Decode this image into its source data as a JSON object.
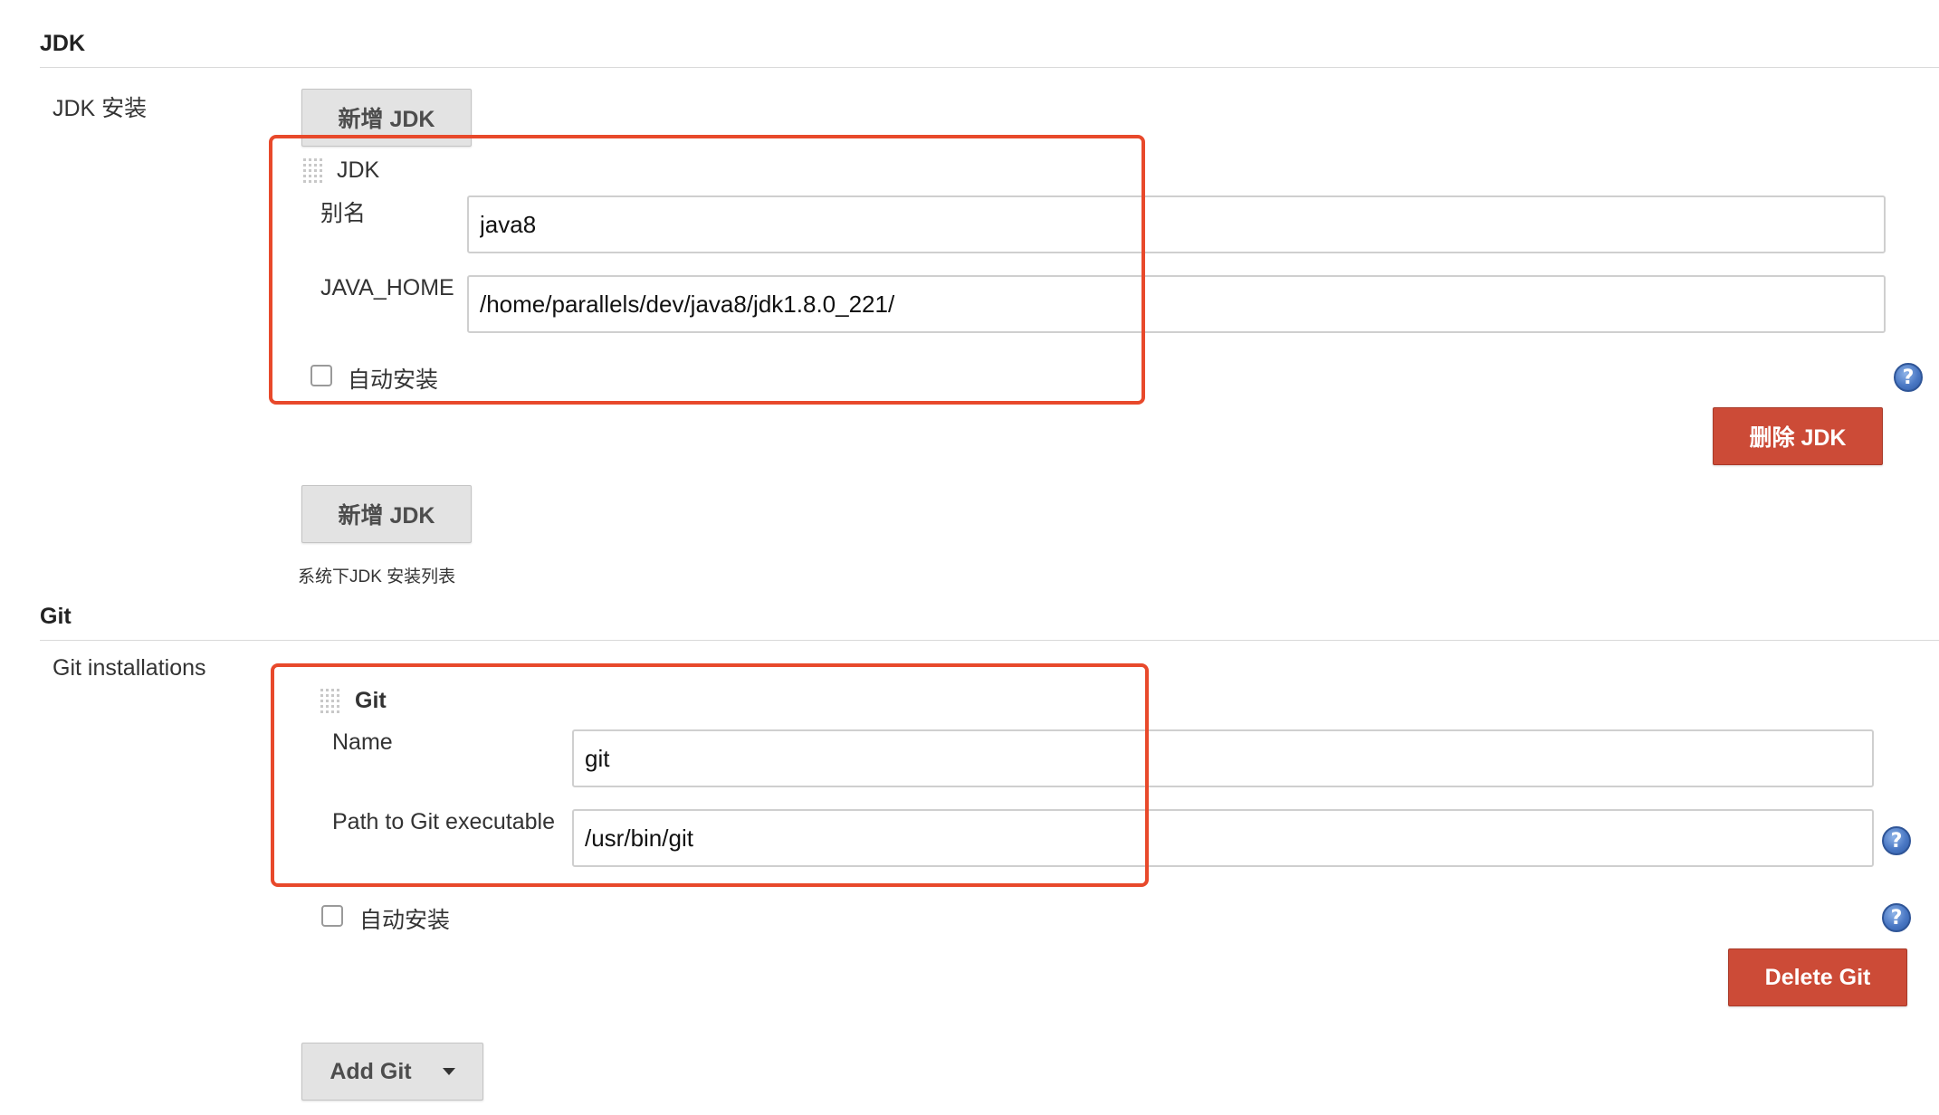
{
  "jdk": {
    "section_title": "JDK",
    "installations_label": "JDK 安装",
    "add_button_label": "新增 JDK",
    "item": {
      "header": "JDK",
      "alias_label": "别名",
      "alias_value": "java8",
      "java_home_label": "JAVA_HOME",
      "java_home_value": "/home/parallels/dev/java8/jdk1.8.0_221/",
      "auto_install_label": "自动安装",
      "auto_install_checked": false,
      "delete_button_label": "删除 JDK"
    },
    "add_button_bottom_label": "新增 JDK",
    "hint": "系统下JDK 安装列表"
  },
  "git": {
    "section_title": "Git",
    "installations_label": "Git installations",
    "item": {
      "header": "Git",
      "name_label": "Name",
      "name_value": "git",
      "path_label": "Path to Git executable",
      "path_value": "/usr/bin/git",
      "auto_install_label": "自动安装",
      "auto_install_checked": false,
      "delete_button_label": "Delete Git"
    },
    "add_button_label": "Add Git"
  },
  "icons": {
    "help": "help-icon",
    "grip": "drag-handle-icon",
    "dropdown": "caret-down-icon"
  },
  "help_glyph": "?",
  "colors": {
    "highlight_border": "#e8492b",
    "delete_button": "#cc4b37",
    "neutral_button": "#e3e3e3",
    "help_icon": "#4a78c4"
  }
}
